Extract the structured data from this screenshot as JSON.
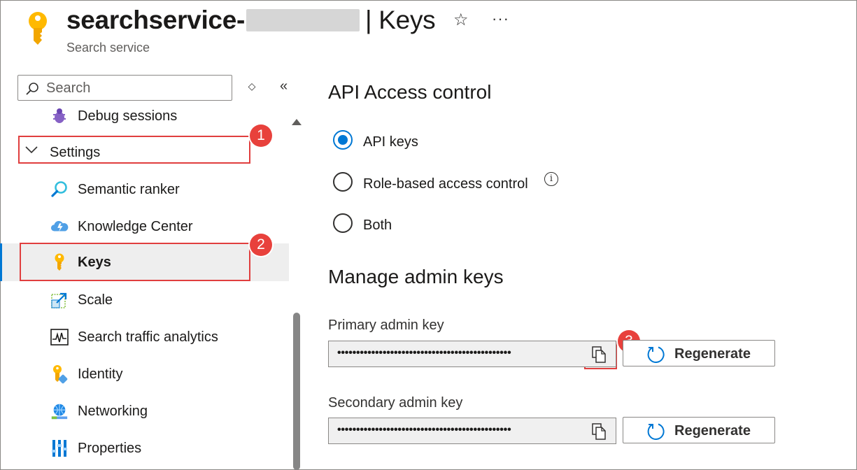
{
  "header": {
    "title": "searchservice-",
    "title_suffix": "| Keys",
    "subtitle": "Search service"
  },
  "sidebar": {
    "search_placeholder": "Search",
    "items": [
      {
        "label": "Debug sessions",
        "icon": "debug-icon"
      },
      {
        "label": "Settings",
        "icon": "chevron-down-icon"
      },
      {
        "label": "Semantic ranker",
        "icon": "semantic-search-icon"
      },
      {
        "label": "Knowledge Center",
        "icon": "knowledge-cloud-icon"
      },
      {
        "label": "Keys",
        "icon": "key-icon",
        "active": true
      },
      {
        "label": "Scale",
        "icon": "scale-icon"
      },
      {
        "label": "Search traffic analytics",
        "icon": "analytics-icon"
      },
      {
        "label": "Identity",
        "icon": "identity-icon"
      },
      {
        "label": "Networking",
        "icon": "networking-icon"
      },
      {
        "label": "Properties",
        "icon": "properties-icon"
      }
    ]
  },
  "callouts": [
    "1",
    "2",
    "3"
  ],
  "main": {
    "api_access": {
      "heading": "API Access control",
      "options": [
        {
          "label": "API keys",
          "selected": true
        },
        {
          "label": "Role-based access control",
          "selected": false
        },
        {
          "label": "Both",
          "selected": false
        }
      ],
      "info_glyph": "i"
    },
    "admin_keys": {
      "heading": "Manage admin keys",
      "primary": {
        "label": "Primary admin key",
        "value": "••••••••••••••••••••••••••••••••••••••••••••••",
        "regenerate_label": "Regenerate"
      },
      "secondary": {
        "label": "Secondary admin key",
        "value": "••••••••••••••••••••••••••••••••••••••••••••••",
        "regenerate_label": "Regenerate"
      }
    }
  },
  "colors": {
    "accent": "#0078d4",
    "callout": "#e8413c",
    "key_gold": "#ffb900"
  }
}
